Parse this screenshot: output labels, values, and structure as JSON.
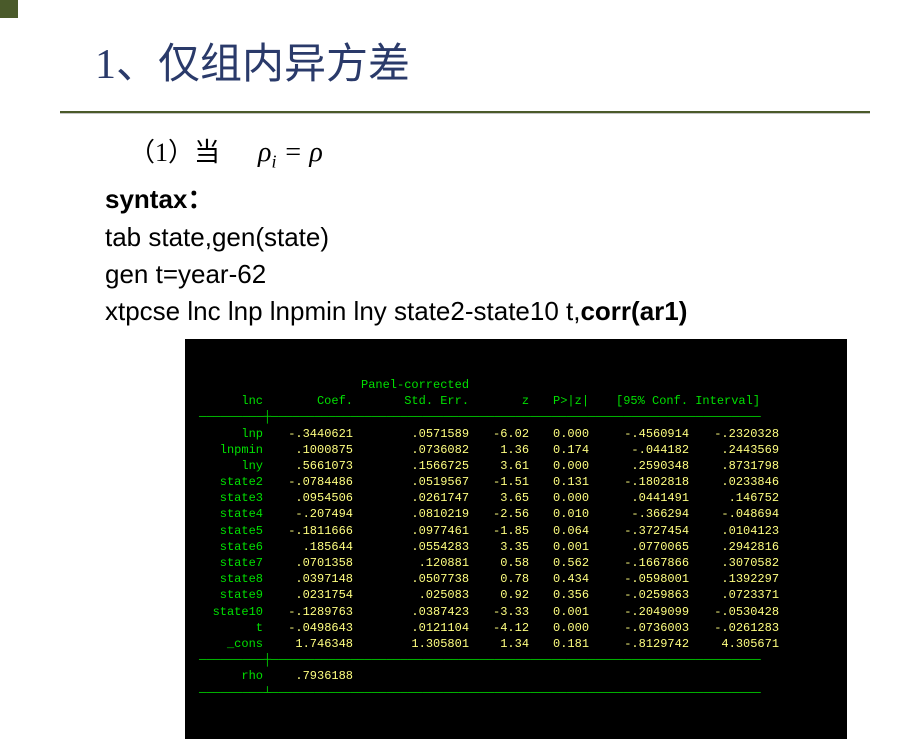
{
  "title": "1、仅组内异方差",
  "line1_prefix": "（1）当",
  "formula": {
    "lhs_rho": "ρ",
    "lhs_sub": "i",
    "eq": " = ",
    "rhs_rho": "ρ"
  },
  "syntax_label": "syntax：",
  "code_lines": {
    "l1": "tab state,gen(state)",
    "l2": "gen t=year-62",
    "l3_a": "xtpcse  lnc lnp lnpmin lny state2-state10 t,",
    "l3_b": "corr(ar1)"
  },
  "terminal": {
    "header_title": "Panel-corrected",
    "cols": [
      "lnc",
      "Coef.",
      "Std. Err.",
      "z",
      "P>|z|",
      "[95% Conf. Interval]",
      ""
    ],
    "rows": [
      {
        "var": "lnp",
        "coef": "-.3440621",
        "se": ".0571589",
        "z": "-6.02",
        "p": "0.000",
        "lo": "-.4560914",
        "hi": "-.2320328"
      },
      {
        "var": "lnpmin",
        "coef": ".1000875",
        "se": ".0736082",
        "z": "1.36",
        "p": "0.174",
        "lo": "-.044182",
        "hi": ".2443569"
      },
      {
        "var": "lny",
        "coef": ".5661073",
        "se": ".1566725",
        "z": "3.61",
        "p": "0.000",
        "lo": ".2590348",
        "hi": ".8731798"
      },
      {
        "var": "state2",
        "coef": "-.0784486",
        "se": ".0519567",
        "z": "-1.51",
        "p": "0.131",
        "lo": "-.1802818",
        "hi": ".0233846"
      },
      {
        "var": "state3",
        "coef": ".0954506",
        "se": ".0261747",
        "z": "3.65",
        "p": "0.000",
        "lo": ".0441491",
        "hi": ".146752"
      },
      {
        "var": "state4",
        "coef": "-.207494",
        "se": ".0810219",
        "z": "-2.56",
        "p": "0.010",
        "lo": "-.366294",
        "hi": "-.048694"
      },
      {
        "var": "state5",
        "coef": "-.1811666",
        "se": ".0977461",
        "z": "-1.85",
        "p": "0.064",
        "lo": "-.3727454",
        "hi": ".0104123"
      },
      {
        "var": "state6",
        "coef": ".185644",
        "se": ".0554283",
        "z": "3.35",
        "p": "0.001",
        "lo": ".0770065",
        "hi": ".2942816"
      },
      {
        "var": "state7",
        "coef": ".0701358",
        "se": ".120881",
        "z": "0.58",
        "p": "0.562",
        "lo": "-.1667866",
        "hi": ".3070582"
      },
      {
        "var": "state8",
        "coef": ".0397148",
        "se": ".0507738",
        "z": "0.78",
        "p": "0.434",
        "lo": "-.0598001",
        "hi": ".1392297"
      },
      {
        "var": "state9",
        "coef": ".0231754",
        "se": ".025083",
        "z": "0.92",
        "p": "0.356",
        "lo": "-.0259863",
        "hi": ".0723371"
      },
      {
        "var": "state10",
        "coef": "-.1289763",
        "se": ".0387423",
        "z": "-3.33",
        "p": "0.001",
        "lo": "-.2049099",
        "hi": "-.0530428"
      },
      {
        "var": "t",
        "coef": "-.0498643",
        "se": ".0121104",
        "z": "-4.12",
        "p": "0.000",
        "lo": "-.0736003",
        "hi": "-.0261283"
      },
      {
        "var": "_cons",
        "coef": "1.746348",
        "se": "1.305801",
        "z": "1.34",
        "p": "0.181",
        "lo": "-.8129742",
        "hi": "4.305671"
      }
    ],
    "rho_label": "rho",
    "rho_value": ".7936188"
  }
}
